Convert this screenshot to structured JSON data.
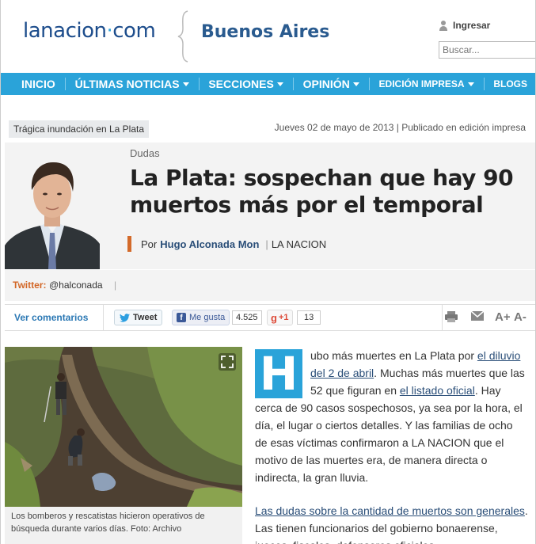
{
  "header": {
    "logo_main": "lanacion",
    "logo_dot": "·",
    "logo_suffix": "com",
    "city": "Buenos Aires",
    "login_label": "Ingresar",
    "search_placeholder": "Buscar..."
  },
  "nav": {
    "items": [
      {
        "label": "INICIO",
        "has_caret": false
      },
      {
        "label": "ÚLTIMAS NOTICIAS",
        "has_caret": true
      },
      {
        "label": "SECCIONES",
        "has_caret": true
      },
      {
        "label": "OPINIÓN",
        "has_caret": true
      },
      {
        "label": "EDICIÓN IMPRESA",
        "has_caret": true
      },
      {
        "label": "BLOGS",
        "has_caret": false
      }
    ]
  },
  "article": {
    "section_tag": "Trágica inundación en La Plata",
    "dateline": "Jueves 02 de mayo de 2013 | Publicado en edición impresa",
    "kicker": "Dudas",
    "headline_line1": "La Plata: sospechan que hay 90",
    "headline_line2": "muertos más por el temporal",
    "byline_prefix": "Por",
    "author": "Hugo Alconada Mon",
    "byline_sep": "|",
    "outlet": "LA NACION",
    "twitter_label": "Twitter:",
    "twitter_handle": "@halconada",
    "twitter_sep": "|"
  },
  "social": {
    "comments_label": "Ver comentarios",
    "tweet_label": "Tweet",
    "like_label": "Me gusta",
    "like_count": "4.525",
    "gplus_label": "+1",
    "gplus_count": "13",
    "font_up": "A+",
    "font_down": "A-"
  },
  "photo": {
    "caption": "Los bomberos y rescatistas hicieron operativos de búsqueda durante varios días. Foto: Archivo"
  },
  "body": {
    "dropcap": "H",
    "p1_a": "ubo más muertes en La Plata por ",
    "p1_link1": "el diluvio del 2 de abril",
    "p1_b": ". Muchas más muertes que las 52 que figuran en ",
    "p1_link2": "el listado oficial",
    "p1_c": ". Hay cerca de 90 casos sospechosos, ya sea por la hora, el día, el lugar o ciertos detalles. Y las familias de ocho de esas víctimas confirmaron a LA NACION que el motivo de las muertes era, de manera directa o indirecta, la gran lluvia.",
    "p2_link": "Las dudas sobre la cantidad de muertos son generales",
    "p2_a": ". Las tienen funcionarios del gobierno bonaerense, jueces, fiscales, defensores oficiales,"
  },
  "colors": {
    "brand_blue": "#2aa3d9",
    "logo_navy": "#1d4d8c",
    "accent_orange": "#d36a2a"
  }
}
